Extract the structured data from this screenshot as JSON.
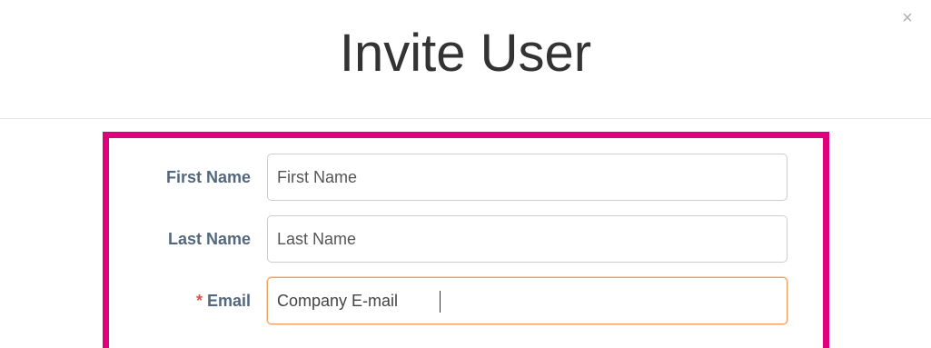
{
  "modal": {
    "title": "Invite User",
    "close_symbol": "×"
  },
  "form": {
    "first_name": {
      "label": "First Name",
      "placeholder": "First Name",
      "value": ""
    },
    "last_name": {
      "label": "Last Name",
      "placeholder": "Last Name",
      "value": ""
    },
    "email": {
      "required_mark": "*",
      "label": "Email",
      "placeholder": "Company E-mail",
      "value": ""
    }
  },
  "colors": {
    "highlight": "#e2007a",
    "label": "#53687e",
    "focus_border": "#f0a35f",
    "required": "#d9534f"
  }
}
